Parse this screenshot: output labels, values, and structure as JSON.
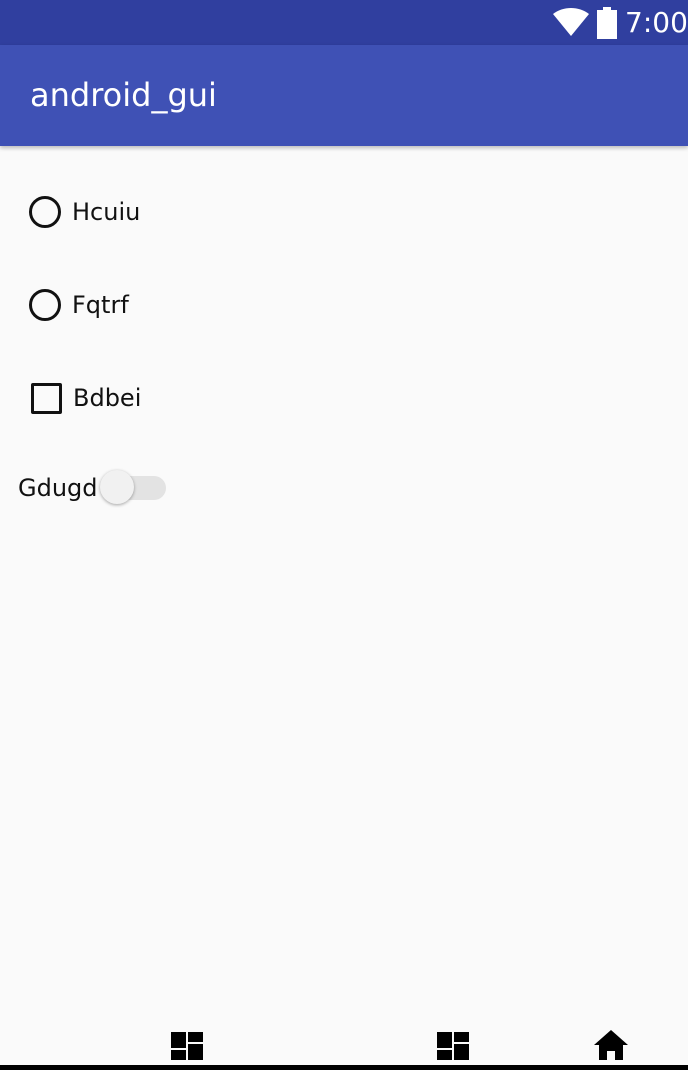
{
  "status_bar": {
    "time": "7:00",
    "icons": [
      "wifi-icon",
      "battery-icon"
    ]
  },
  "app_bar": {
    "title": "android_gui"
  },
  "options": [
    {
      "type": "radio",
      "label": "Hcuiu",
      "checked": false
    },
    {
      "type": "radio",
      "label": "Fqtrf",
      "checked": false
    },
    {
      "type": "checkbox",
      "label": "Bdbei",
      "checked": false
    }
  ],
  "switch": {
    "label": "Gdugd",
    "on": false
  },
  "nav_bar": {
    "icons": [
      "dashboard-icon",
      "dashboard-icon",
      "home-icon"
    ]
  },
  "colors": {
    "status_bar": "#303f9f",
    "app_bar": "#3f51b5",
    "background": "#fafafa"
  }
}
